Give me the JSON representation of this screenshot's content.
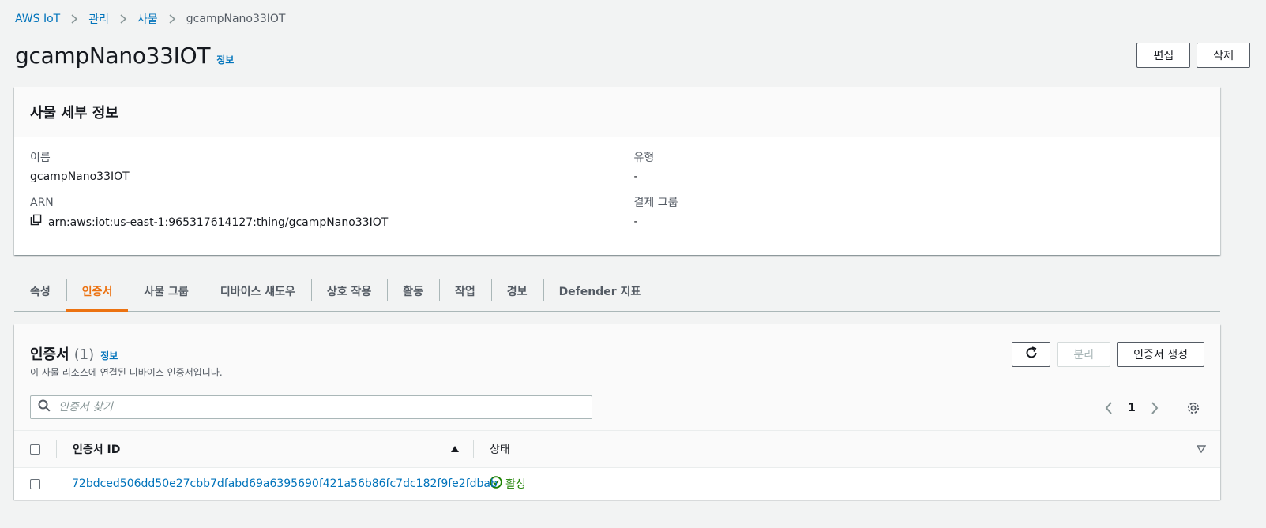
{
  "breadcrumb": {
    "items": [
      "AWS IoT",
      "관리",
      "사물"
    ],
    "current": "gcampNano33IOT"
  },
  "header": {
    "title": "gcampNano33IOT",
    "info": "정보",
    "edit_label": "편집",
    "delete_label": "삭제"
  },
  "details": {
    "title": "사물 세부 정보",
    "name_label": "이름",
    "name_value": "gcampNano33IOT",
    "arn_label": "ARN",
    "arn_value": "arn:aws:iot:us-east-1:965317614127:thing/gcampNano33IOT",
    "type_label": "유형",
    "type_value": "-",
    "billing_label": "결제 그룹",
    "billing_value": "-"
  },
  "tabs": [
    {
      "label": "속성",
      "active": false
    },
    {
      "label": "인증서",
      "active": true
    },
    {
      "label": "사물 그룹",
      "active": false
    },
    {
      "label": "디바이스 섀도우",
      "active": false
    },
    {
      "label": "상호 작용",
      "active": false
    },
    {
      "label": "활동",
      "active": false
    },
    {
      "label": "작업",
      "active": false
    },
    {
      "label": "경보",
      "active": false
    },
    {
      "label": "Defender 지표",
      "active": false
    }
  ],
  "certificates": {
    "title": "인증서",
    "count": "(1)",
    "info": "정보",
    "description": "이 사물 리소스에 연결된 디바이스 인증서입니다.",
    "detach_label": "분리",
    "create_label": "인증서 생성",
    "search_placeholder": "인증서 찾기",
    "page": "1",
    "columns": {
      "id": "인증서 ID",
      "status": "상태"
    },
    "rows": [
      {
        "id": "72bdced506dd50e27cbb7dfabd69a6395690f421a56b86fc7dc182f9fe2fdbab",
        "status": "활성"
      }
    ]
  },
  "colors": {
    "link": "#0073bb",
    "active_tab": "#ec7211",
    "success": "#1d8102",
    "background": "#f2f3f3"
  },
  "icons": {
    "copy": "copy-icon",
    "refresh": "refresh-icon",
    "search": "search-icon",
    "settings": "gear-icon",
    "status": "check-circle-icon"
  }
}
